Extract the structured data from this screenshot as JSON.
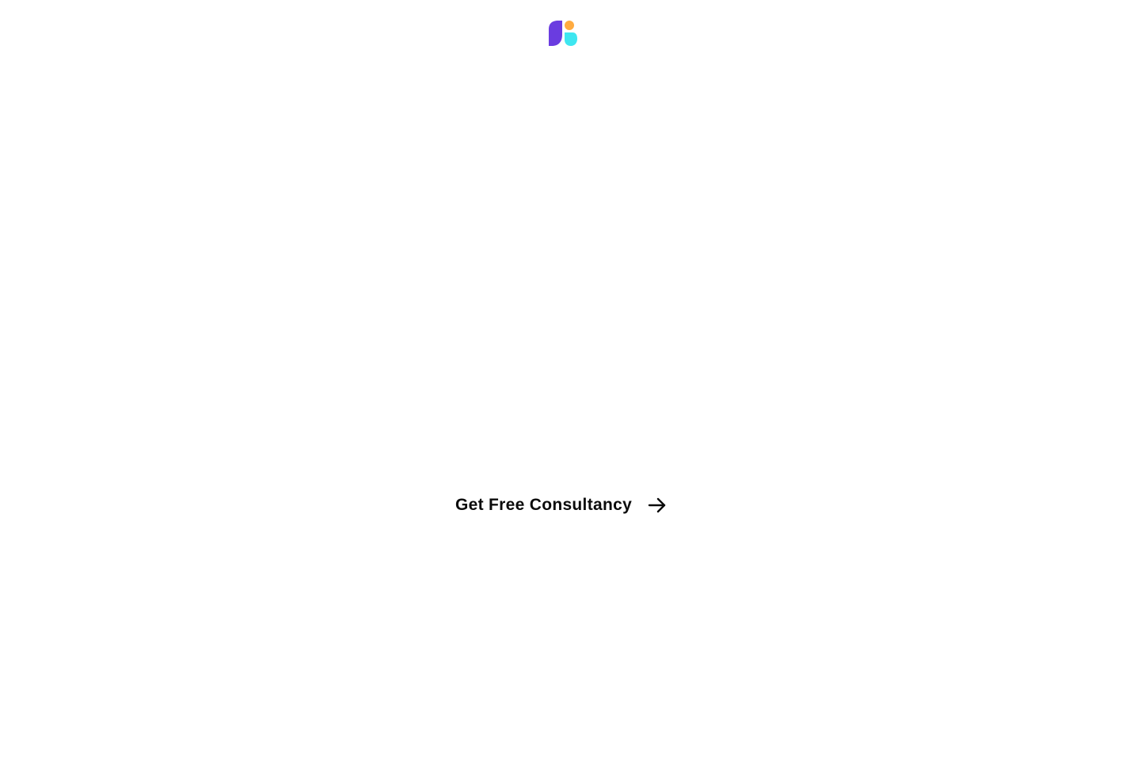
{
  "brand": {
    "logo_icon": "brand-logo-icon",
    "colors": {
      "purple": "#6a3ce0",
      "orange": "#ffab40",
      "cyan": "#3ee6f0"
    }
  },
  "cta": {
    "label": "Get Free Consultancy",
    "icon": "arrow-right-icon",
    "color": "#0b0b0b"
  }
}
